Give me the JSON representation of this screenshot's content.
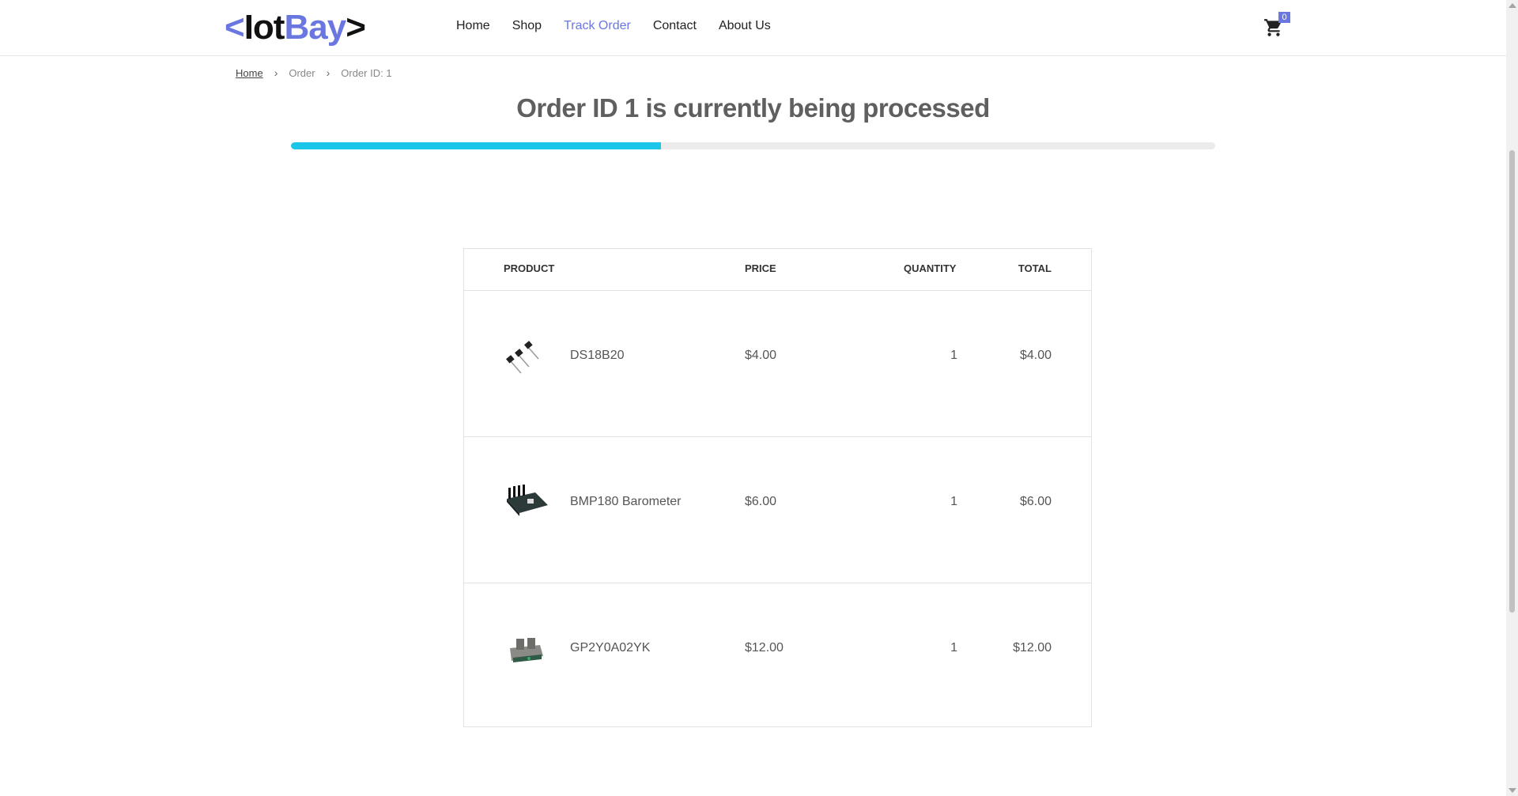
{
  "header": {
    "logo": {
      "lt": "<",
      "iot": "Iot",
      "bay": "Bay",
      "gt": ">"
    },
    "nav": [
      "Home",
      "Shop",
      "Track Order",
      "Contact",
      "About Us"
    ],
    "active_nav": "Track Order",
    "cart_count": "0",
    "accent_color": "#6a77e0"
  },
  "breadcrumb": {
    "home": "Home",
    "order": "Order",
    "current": "Order ID: 1"
  },
  "title": "Order ID 1 is currently being processed",
  "progress": {
    "percent": 40,
    "color": "#1cc6e8"
  },
  "table": {
    "headers": {
      "product": "PRODUCT",
      "price": "PRICE",
      "quantity": "QUANTITY",
      "total": "TOTAL"
    },
    "rows": [
      {
        "name": "DS18B20",
        "price": "$4.00",
        "quantity": "1",
        "total": "$4.00",
        "icon": "transistor-sensor-icon"
      },
      {
        "name": "BMP180 Barometer",
        "price": "$6.00",
        "quantity": "1",
        "total": "$6.00",
        "icon": "barometer-board-icon"
      },
      {
        "name": "GP2Y0A02YK",
        "price": "$12.00",
        "quantity": "1",
        "total": "$12.00",
        "icon": "ir-distance-sensor-icon"
      }
    ]
  }
}
